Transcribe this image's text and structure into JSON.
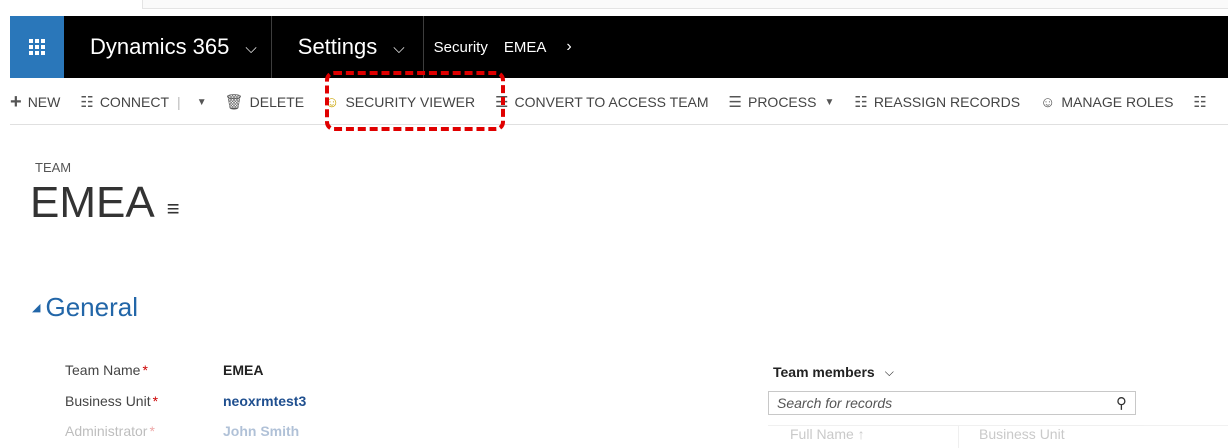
{
  "nav": {
    "app_name": "Dynamics 365",
    "area": "Settings",
    "breadcrumb_section": "Security",
    "breadcrumb_record": "EMEA"
  },
  "commands": {
    "new": "NEW",
    "connect": "CONNECT",
    "delete": "DELETE",
    "security_viewer": "SECURITY VIEWER",
    "convert": "CONVERT TO ACCESS TEAM",
    "process": "PROCESS",
    "reassign": "REASSIGN RECORDS",
    "manage_roles": "MANAGE ROLES"
  },
  "record": {
    "entity_label": "TEAM",
    "title": "EMEA"
  },
  "section": {
    "title": "General"
  },
  "fields": [
    {
      "label": "Team Name",
      "value": "EMEA"
    },
    {
      "label": "Business Unit",
      "value": "neoxrmtest3"
    },
    {
      "label": "Administrator",
      "value": "John Smith"
    }
  ],
  "subgrid": {
    "title": "Team members",
    "search_placeholder": "Search for records",
    "columns": [
      "Full Name ↑",
      "Business Unit"
    ]
  },
  "colors": {
    "nav_bg": "#000000",
    "waffle_bg": "#2a77ba",
    "section_title": "#2266a8",
    "highlight": "#e00000",
    "required": "#cc0000"
  }
}
